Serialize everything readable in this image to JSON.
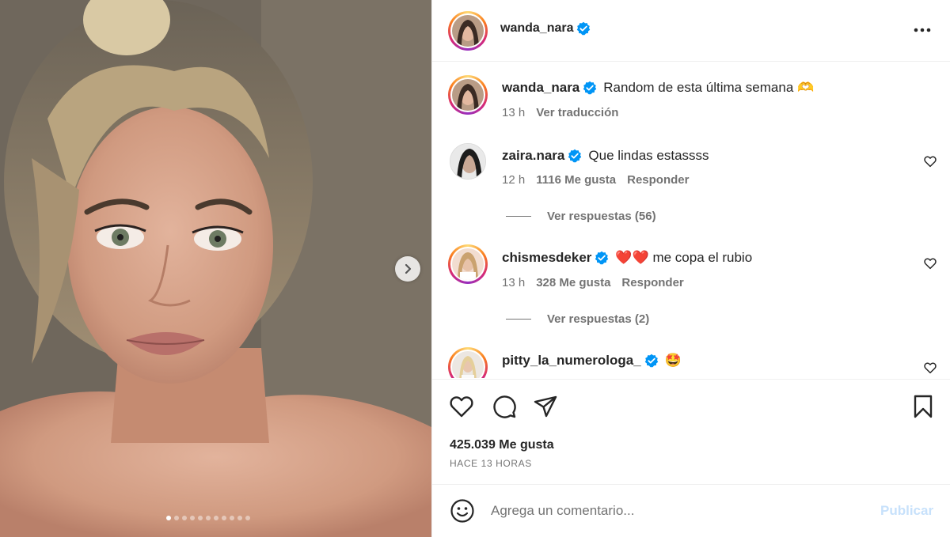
{
  "post": {
    "author": "wanda_nara",
    "caption": "Random de esta última semana 🫶",
    "caption_time": "13 h",
    "translate_label": "Ver traducción",
    "likes": "425.039 Me gusta",
    "time_ago": "HACE 13 HORAS",
    "carousel": {
      "total_slides": 11,
      "active_index": 0
    }
  },
  "comments": [
    {
      "username": "zaira.nara",
      "text": "Que lindas estassss",
      "time": "12 h",
      "likes": "1116 Me gusta",
      "reply_label": "Responder",
      "view_replies": "Ver respuestas (56)"
    },
    {
      "username": "chismesdeker",
      "text": "❤️❤️ me copa el rubio",
      "time": "13 h",
      "likes": "328 Me gusta",
      "reply_label": "Responder",
      "view_replies": "Ver respuestas (2)"
    },
    {
      "username": "pitty_la_numerologa_",
      "text": "🤩"
    }
  ],
  "composer": {
    "placeholder": "Agrega un comentario...",
    "publish_label": "Publicar"
  },
  "icons": {
    "verified": "verified-badge-icon",
    "more": "more-options-icon",
    "like": "heart-icon",
    "comment": "comment-icon",
    "share": "paper-plane-icon",
    "save": "bookmark-icon",
    "emoji": "smiley-icon",
    "next": "chevron-right-icon"
  },
  "colors": {
    "verified": "#0095f6",
    "publish_disabled": "#c7e1fb",
    "text_primary": "#262626",
    "text_secondary": "#737373",
    "divider": "#efefef"
  }
}
